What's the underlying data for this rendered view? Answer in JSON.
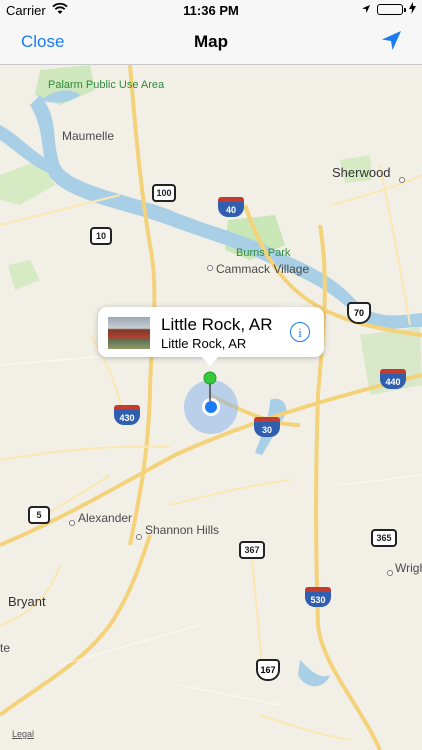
{
  "status_bar": {
    "carrier": "Carrier",
    "time": "11:36 PM"
  },
  "nav": {
    "close_label": "Close",
    "title": "Map"
  },
  "map": {
    "places": {
      "palarm": "Palarm Public Use Area",
      "maumelle": "Maumelle",
      "sherwood": "Sherwood",
      "burns_park": "Burns Park",
      "cammack": "Cammack Village",
      "alexander": "Alexander",
      "shannon_hills": "Shannon Hills",
      "bryant": "Bryant",
      "wrigh": "Wrigh",
      "te": "te"
    },
    "shields": {
      "s100": "100",
      "s10": "10",
      "i40": "40",
      "u70": "70",
      "i440": "440",
      "i430": "430",
      "i30": "30",
      "s5": "5",
      "s367": "367",
      "s365": "365",
      "i530": "530",
      "s167": "167"
    },
    "legal_label": "Legal"
  },
  "callout": {
    "title": "Little Rock, AR",
    "subtitle": "Little Rock, AR",
    "info_label": "i"
  }
}
